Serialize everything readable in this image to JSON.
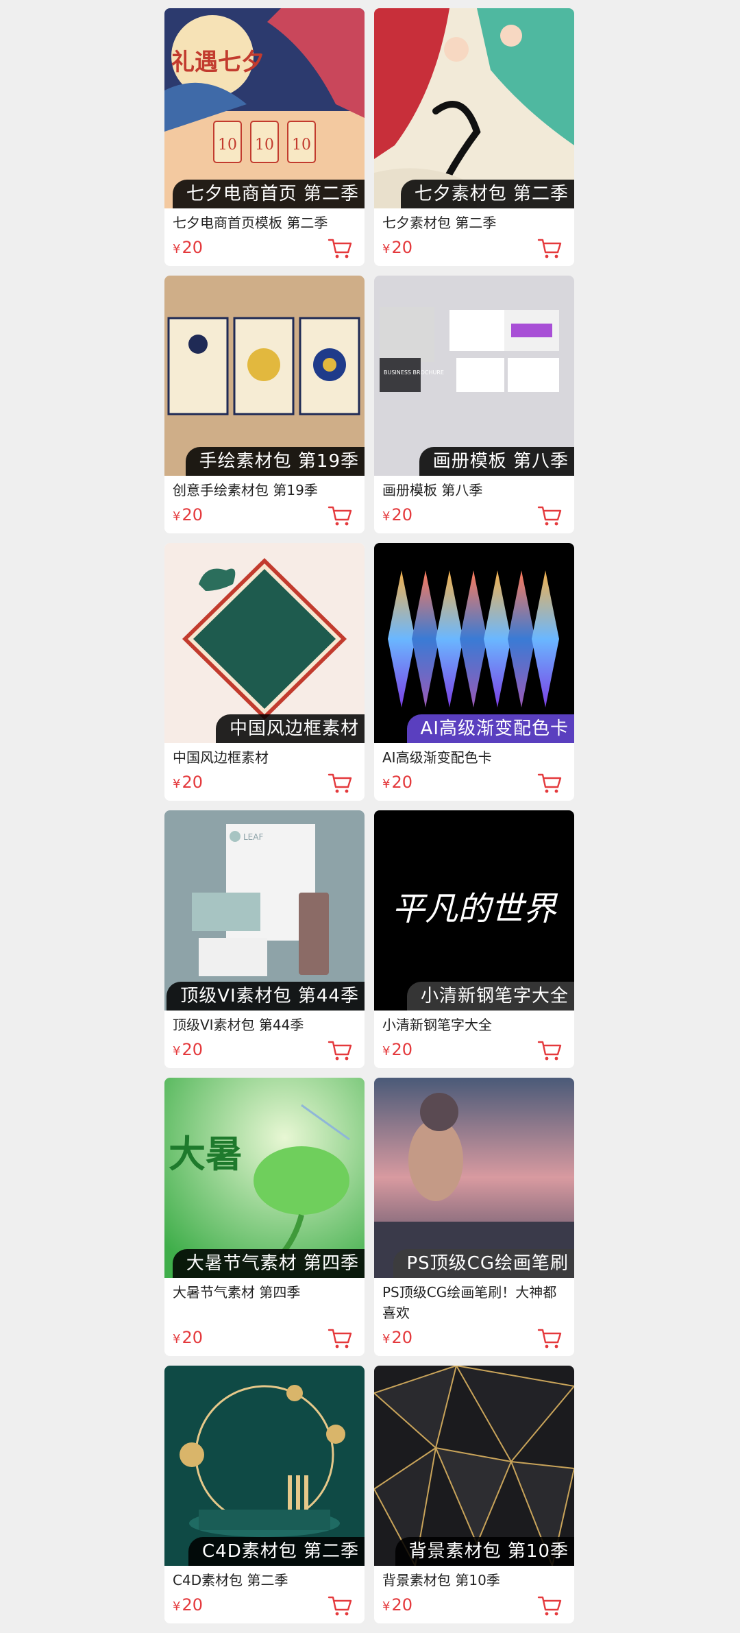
{
  "currency": "¥",
  "products": [
    {
      "badge": "七夕电商首页 第二季",
      "title": "七夕电商首页模板 第二季",
      "price": "20"
    },
    {
      "badge": "七夕素材包 第二季",
      "title": "七夕素材包 第二季",
      "price": "20"
    },
    {
      "badge": "手绘素材包 第19季",
      "title": "创意手绘素材包 第19季",
      "price": "20"
    },
    {
      "badge": "画册模板 第八季",
      "title": "画册模板 第八季",
      "price": "20"
    },
    {
      "badge": "中国风边框素材",
      "title": "中国风边框素材",
      "price": "20"
    },
    {
      "badge": "AI高级渐变配色卡",
      "title": "AI高级渐变配色卡",
      "price": "20"
    },
    {
      "badge": "顶级VI素材包 第44季",
      "title": "顶级VI素材包 第44季",
      "price": "20"
    },
    {
      "badge": "小清新钢笔字大全",
      "title": "小清新钢笔字大全",
      "price": "20"
    },
    {
      "badge": "大暑节气素材 第四季",
      "title": "大暑节气素材 第四季",
      "price": "20"
    },
    {
      "badge": "PS顶级CG绘画笔刷",
      "title": "PS顶级CG绘画笔刷！大神都喜欢",
      "price": "20"
    },
    {
      "badge": "C4D素材包 第二季",
      "title": "C4D素材包 第二季",
      "price": "20"
    },
    {
      "badge": "背景素材包 第10季",
      "title": "背景素材包 第10季",
      "price": "20"
    }
  ],
  "thumb_text": {
    "qixi_title": "礼遇七夕",
    "qixi_sub": "七夕",
    "coupon_value": "10",
    "brochure_title": "BUSINESS BROCHURE",
    "vi_brand": "LEAF",
    "calligraphy": "平凡的世界",
    "dashu": "大暑"
  },
  "icons": {
    "cart": "cart-icon"
  },
  "colors": {
    "price": "#e4393c",
    "page_bg": "#efefef"
  }
}
